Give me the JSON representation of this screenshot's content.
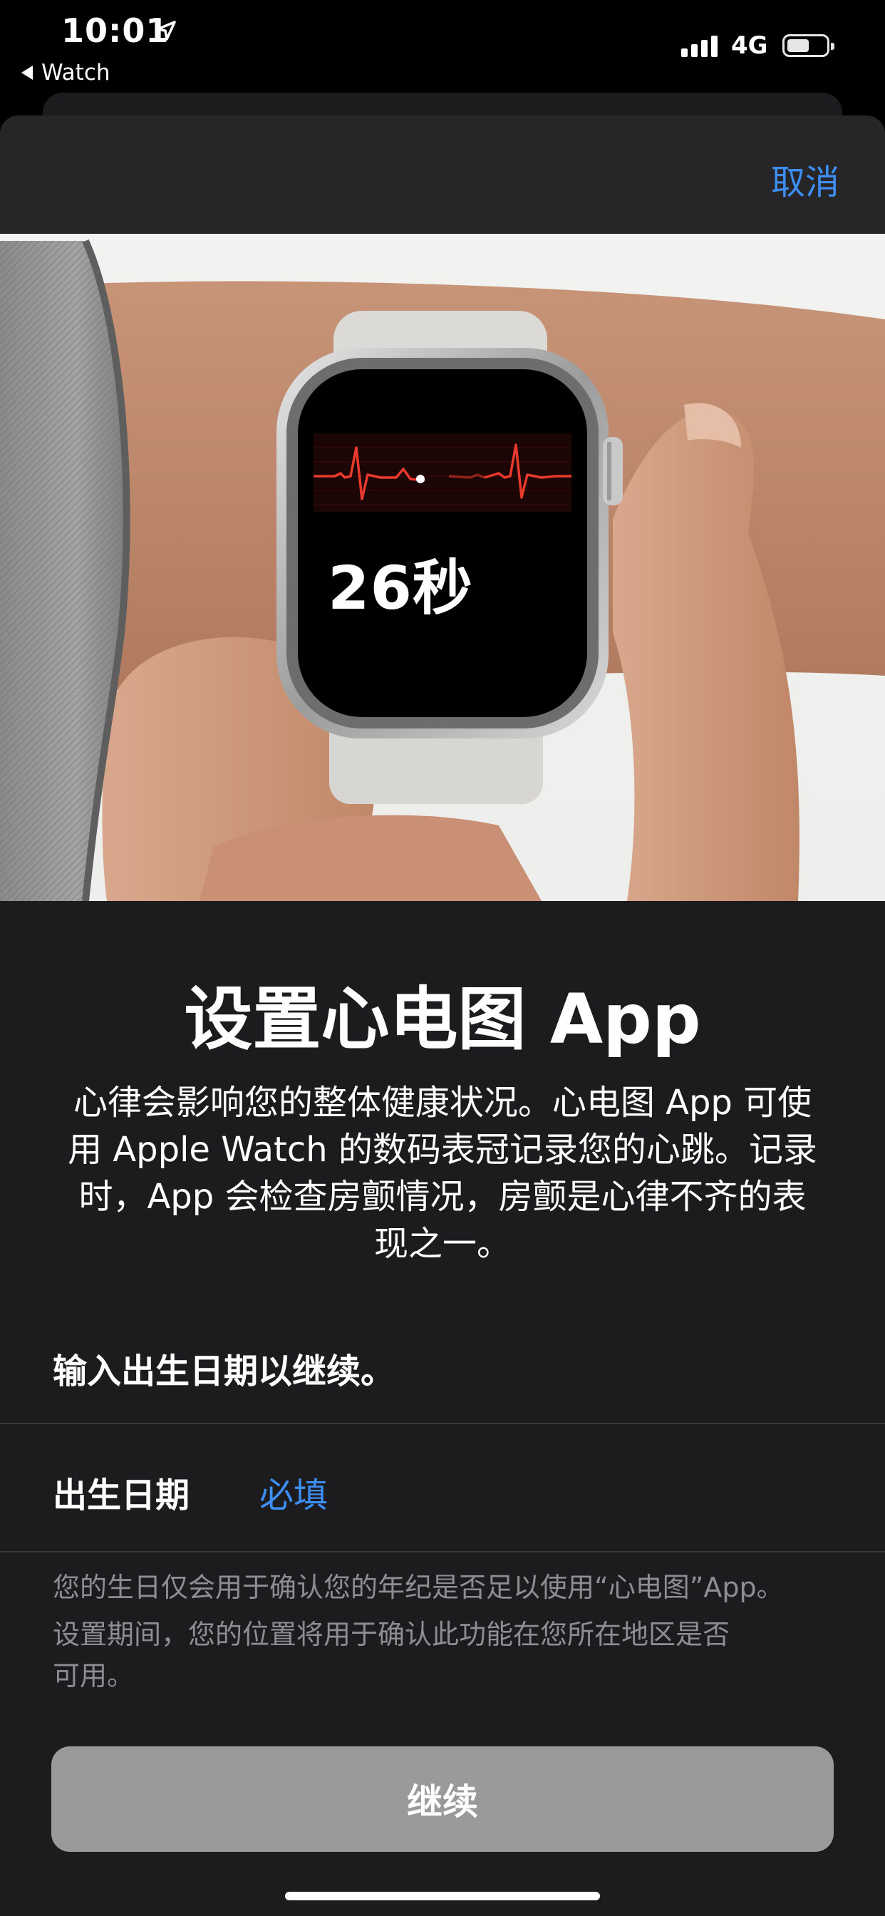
{
  "status_bar": {
    "time": "10:01",
    "back_label": "Watch",
    "network": "4G",
    "icons": [
      "location-arrow-icon",
      "signal-bars-icon",
      "battery-icon"
    ]
  },
  "nav": {
    "cancel_label": "取消"
  },
  "hero": {
    "watch_timer": "26秒",
    "image": "hand-touching-apple-watch-crown-ecg"
  },
  "content": {
    "title": "设置心电图 App",
    "description_lines": [
      "心律会影响您的整体健康状况。心电图 App 可使",
      "用 Apple Watch 的数码表冠记录您的心跳。记录",
      "时，App 会检查房颤情况，房颤是心律不齐的表",
      "现之一。"
    ],
    "prompt": "输入出生日期以继续。",
    "dob_label": "出生日期",
    "dob_value": "必填",
    "footnote1": "您的生日仅会用于确认您的年纪是否足以使用“心电图”App。",
    "footnote2_lines": [
      "设置期间，您的位置将用于确认此功能在您所在地区是否",
      "可用。"
    ],
    "continue_label": "继续"
  },
  "colors": {
    "accent_blue": "#3d8ff5",
    "sheet_background": "#1c1c1e",
    "nav_background": "#262628",
    "disabled_button": "#9a9a9c",
    "ecg_red": "#e8392c"
  }
}
